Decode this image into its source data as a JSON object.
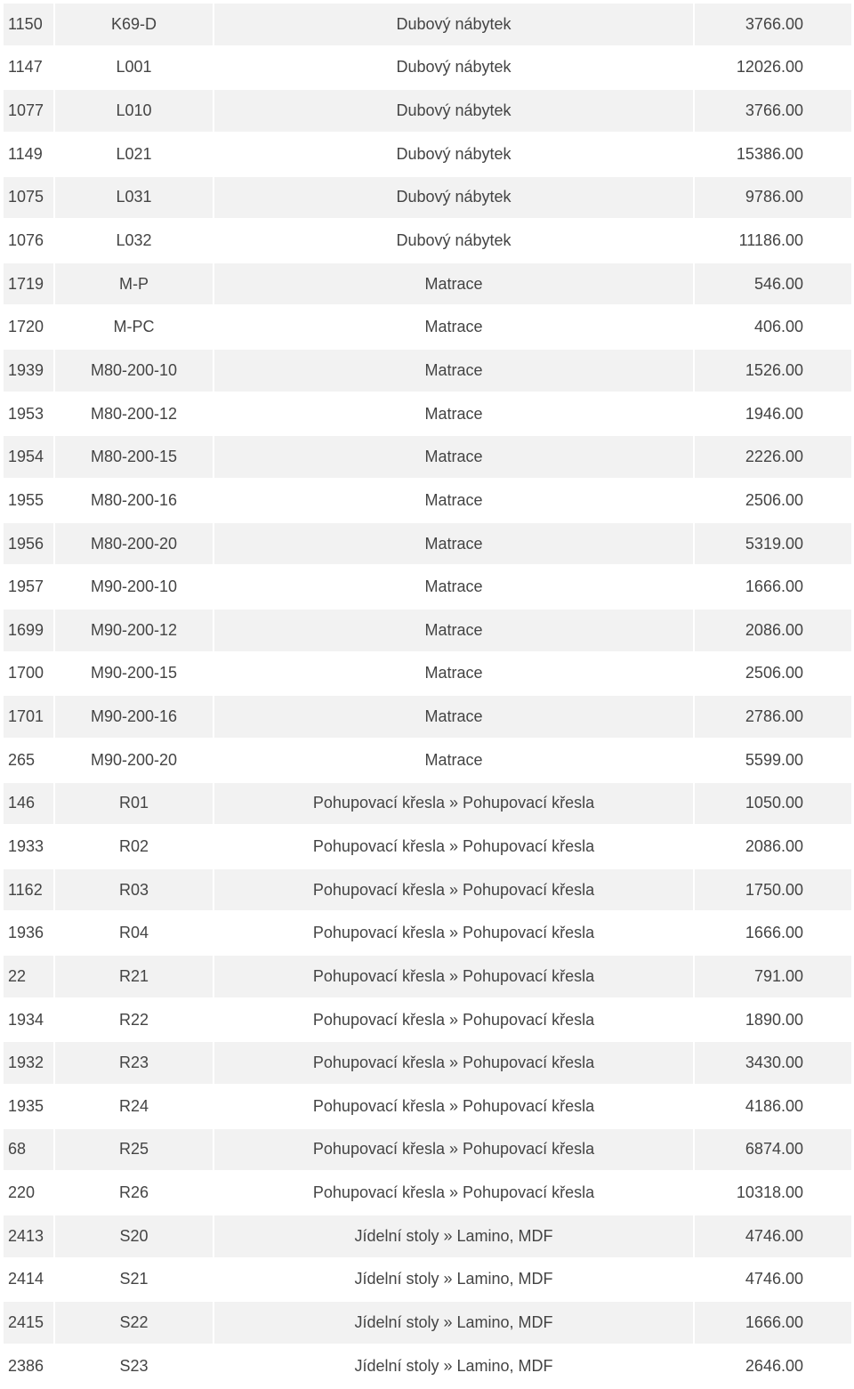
{
  "colors": {
    "row_alt": "#f2f2f2",
    "row_base": "#ffffff",
    "text": "#444444",
    "accent_category": "#e8a317"
  },
  "table": {
    "rows": [
      {
        "id": "1150",
        "code": "K69-D",
        "category": "Dubový nábytek",
        "price": "3766.00"
      },
      {
        "id": "1147",
        "code": "L001",
        "category": "Dubový nábytek",
        "price": "12026.00"
      },
      {
        "id": "1077",
        "code": "L010",
        "category": "Dubový nábytek",
        "price": "3766.00"
      },
      {
        "id": "1149",
        "code": "L021",
        "category": "Dubový nábytek",
        "price": "15386.00"
      },
      {
        "id": "1075",
        "code": "L031",
        "category": "Dubový nábytek",
        "price": "9786.00"
      },
      {
        "id": "1076",
        "code": "L032",
        "category": "Dubový nábytek",
        "price": "11186.00"
      },
      {
        "id": "1719",
        "code": "M-P",
        "category": "Matrace",
        "price": "546.00",
        "accent": true
      },
      {
        "id": "1720",
        "code": "M-PC",
        "category": "Matrace",
        "price": "406.00",
        "accent": true
      },
      {
        "id": "1939",
        "code": "M80-200-10",
        "category": "Matrace",
        "price": "1526.00",
        "accent": true
      },
      {
        "id": "1953",
        "code": "M80-200-12",
        "category": "Matrace",
        "price": "1946.00",
        "accent": true
      },
      {
        "id": "1954",
        "code": "M80-200-15",
        "category": "Matrace",
        "price": "2226.00",
        "accent": true
      },
      {
        "id": "1955",
        "code": "M80-200-16",
        "category": "Matrace",
        "price": "2506.00",
        "accent": true
      },
      {
        "id": "1956",
        "code": "M80-200-20",
        "category": "Matrace",
        "price": "5319.00",
        "accent": true
      },
      {
        "id": "1957",
        "code": "M90-200-10",
        "category": "Matrace",
        "price": "1666.00",
        "accent": true
      },
      {
        "id": "1699",
        "code": "M90-200-12",
        "category": "Matrace",
        "price": "2086.00",
        "accent": true
      },
      {
        "id": "1700",
        "code": "M90-200-15",
        "category": "Matrace",
        "price": "2506.00",
        "accent": true
      },
      {
        "id": "1701",
        "code": "M90-200-16",
        "category": "Matrace",
        "price": "2786.00",
        "accent": true
      },
      {
        "id": "265",
        "code": "M90-200-20",
        "category": "Matrace",
        "price": "5599.00",
        "accent": true
      },
      {
        "id": "146",
        "code": "R01",
        "category": "Pohupovací křesla » Pohupovací křesla",
        "price": "1050.00"
      },
      {
        "id": "1933",
        "code": "R02",
        "category": "Pohupovací křesla » Pohupovací křesla",
        "price": "2086.00"
      },
      {
        "id": "1162",
        "code": "R03",
        "category": "Pohupovací křesla » Pohupovací křesla",
        "price": "1750.00"
      },
      {
        "id": "1936",
        "code": "R04",
        "category": "Pohupovací křesla » Pohupovací křesla",
        "price": "1666.00"
      },
      {
        "id": "22",
        "code": "R21",
        "category": "Pohupovací křesla » Pohupovací křesla",
        "price": "791.00"
      },
      {
        "id": "1934",
        "code": "R22",
        "category": "Pohupovací křesla » Pohupovací křesla",
        "price": "1890.00"
      },
      {
        "id": "1932",
        "code": "R23",
        "category": "Pohupovací křesla » Pohupovací křesla",
        "price": "3430.00"
      },
      {
        "id": "1935",
        "code": "R24",
        "category": "Pohupovací křesla » Pohupovací křesla",
        "price": "4186.00"
      },
      {
        "id": "68",
        "code": "R25",
        "category": "Pohupovací křesla » Pohupovací křesla",
        "price": "6874.00"
      },
      {
        "id": "220",
        "code": "R26",
        "category": "Pohupovací křesla » Pohupovací křesla",
        "price": "10318.00"
      },
      {
        "id": "2413",
        "code": "S20",
        "category": "Jídelní stoly » Lamino, MDF",
        "price": "4746.00"
      },
      {
        "id": "2414",
        "code": "S21",
        "category": "Jídelní stoly » Lamino, MDF",
        "price": "4746.00"
      },
      {
        "id": "2415",
        "code": "S22",
        "category": "Jídelní stoly » Lamino, MDF",
        "price": "1666.00"
      },
      {
        "id": "2386",
        "code": "S23",
        "category": "Jídelní stoly » Lamino, MDF",
        "price": "2646.00"
      }
    ]
  }
}
